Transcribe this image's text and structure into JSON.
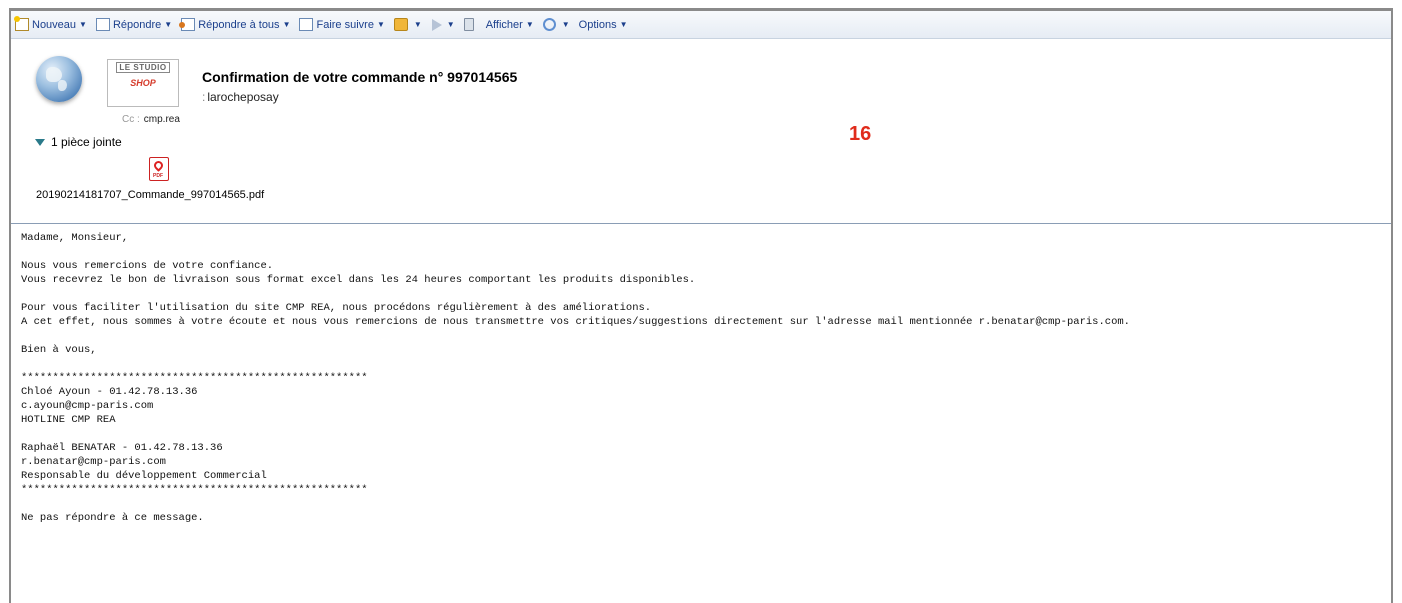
{
  "toolbar": {
    "items": [
      {
        "label": "Nouveau",
        "icon": "new-message-icon"
      },
      {
        "label": "Répondre",
        "icon": "reply-icon"
      },
      {
        "label": "Répondre à tous",
        "icon": "reply-all-icon"
      },
      {
        "label": "Faire suivre",
        "icon": "forward-icon"
      },
      {
        "label": "",
        "icon": "folder-icon"
      },
      {
        "label": "",
        "icon": "flag-icon"
      },
      {
        "label": "",
        "icon": "trash-icon"
      },
      {
        "label": "Afficher",
        "icon": ""
      },
      {
        "label": "",
        "icon": "chat-icon"
      },
      {
        "label": "Options",
        "icon": ""
      }
    ]
  },
  "message": {
    "subject": "Confirmation de votre commande n° 997014565",
    "from": "larocheposay",
    "cc_label": "Cc :",
    "cc": "cmp.rea",
    "logo_top": "LE STUDIO",
    "logo_bottom": "SHOP",
    "attachments_label": "1 pièce jointe",
    "attachment_name": "20190214181707_Commande_997014565.pdf"
  },
  "annotation": "16",
  "body_lines": [
    "Madame, Monsieur,",
    "",
    "Nous vous remercions de votre confiance.",
    "Vous recevrez le bon de livraison sous format excel dans les 24 heures comportant les produits disponibles.",
    "",
    "Pour vous faciliter l'utilisation du site CMP REA, nous procédons régulièrement à des améliorations.",
    "A cet effet, nous sommes à votre écoute et nous vous remercions de nous transmettre vos critiques/suggestions directement sur l'adresse mail mentionnée r.benatar@cmp-paris.com.",
    "",
    "Bien à vous,",
    "",
    "*******************************************************",
    "Chloé Ayoun - 01.42.78.13.36",
    "c.ayoun@cmp-paris.com",
    "HOTLINE CMP REA",
    "",
    "Raphaël BENATAR - 01.42.78.13.36",
    "r.benatar@cmp-paris.com",
    "Responsable du développement Commercial",
    "*******************************************************",
    "",
    "Ne pas répondre à ce message."
  ]
}
